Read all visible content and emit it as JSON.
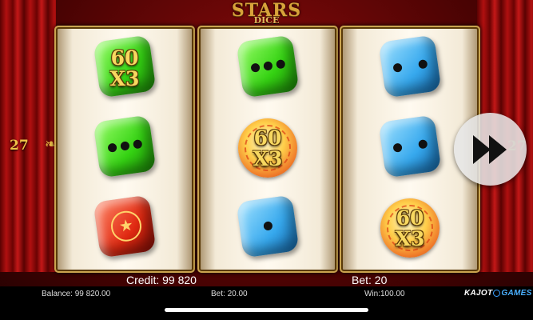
{
  "logo": {
    "top": "STARS",
    "bottom": "DICE"
  },
  "lines": {
    "count": "27",
    "ornament": "❧"
  },
  "reels": [
    [
      {
        "type": "green-die",
        "multiplier": {
          "top": "60",
          "bottom": "X3"
        }
      },
      {
        "type": "green-die"
      },
      {
        "type": "red-star-die"
      }
    ],
    [
      {
        "type": "green-die"
      },
      {
        "type": "scatter-coin",
        "multiplier": {
          "top": "60",
          "bottom": "X3"
        }
      },
      {
        "type": "blue-die"
      }
    ],
    [
      {
        "type": "blue-die"
      },
      {
        "type": "blue-die"
      },
      {
        "type": "scatter-coin",
        "multiplier": {
          "top": "60",
          "bottom": "X3"
        }
      }
    ]
  ],
  "hud": {
    "credit": "Credit: 99 820",
    "bet": "Bet: 20"
  },
  "footer": {
    "balance": "Balance: 99 820.00",
    "bet": "Bet: 20.00",
    "win": "Win:100.00",
    "brand_left": "KAJOT",
    "brand_right": "GAMES"
  },
  "colors": {
    "accent_gold": "#f0c348",
    "background": "#4a0303"
  },
  "icons": {
    "star": "★",
    "fast_forward": "fast-forward-icon"
  }
}
